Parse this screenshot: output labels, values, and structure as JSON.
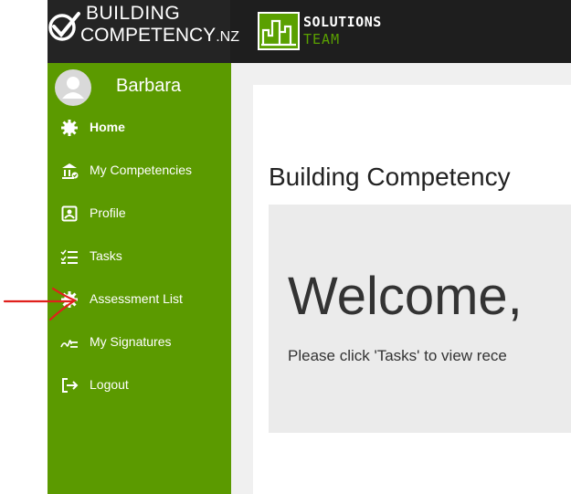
{
  "brand": {
    "line1": "BUILDING",
    "line2": "COMPETENCY",
    "tld": ".NZ"
  },
  "partner": {
    "line1": "SOLUTIONS",
    "line2": "TEAM"
  },
  "user": {
    "name": "Barbara"
  },
  "nav": {
    "items": [
      {
        "label": "Home",
        "icon": "gear-icon",
        "active": true
      },
      {
        "label": "My Competencies",
        "icon": "building-check-icon",
        "active": false
      },
      {
        "label": "Profile",
        "icon": "id-card-icon",
        "active": false
      },
      {
        "label": "Tasks",
        "icon": "checklist-icon",
        "active": false
      },
      {
        "label": "Assessment List",
        "icon": "gear-icon",
        "active": false
      },
      {
        "label": "My Signatures",
        "icon": "signature-icon",
        "active": false
      },
      {
        "label": "Logout",
        "icon": "logout-icon",
        "active": false
      }
    ]
  },
  "main": {
    "title": "Building Competency",
    "welcome": "Welcome,",
    "instruction": "Please click 'Tasks' to view rece"
  },
  "colors": {
    "sidebar": "#5b9a00",
    "topbar": "#1e1e1e",
    "annotation": "#e0201c"
  }
}
